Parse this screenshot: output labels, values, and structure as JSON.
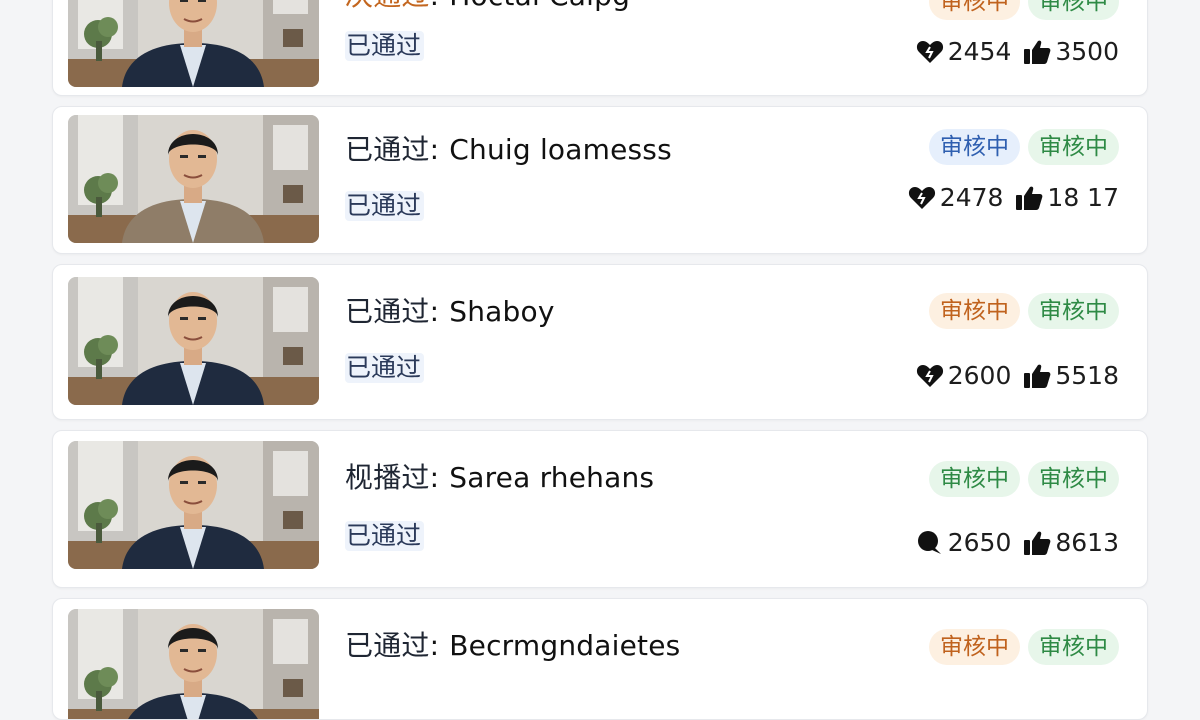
{
  "items": [
    {
      "title_prefix": "决通过",
      "title_name": "Hoctal Calpg",
      "status": "已通过",
      "badges": [
        {
          "label": "审核中",
          "color": "#c0621d"
        },
        {
          "label": "审核中",
          "color": "#2e8a45"
        }
      ],
      "stat_icon_1": "heart-icon",
      "stat_1": "2454",
      "stat_icon_2": "thumbs-up-icon",
      "stat_2": "3500"
    },
    {
      "title_prefix": "已通过",
      "title_name": "Chuig loamesss",
      "status": "已通过",
      "badges": [
        {
          "label": "审核中",
          "color": "#2f5fb0"
        },
        {
          "label": "审核中",
          "color": "#2e8a45"
        }
      ],
      "stat_icon_1": "heart-icon",
      "stat_1": "2478",
      "stat_icon_2": "thumbs-up-icon",
      "stat_2": "18 17"
    },
    {
      "title_prefix": "已通过",
      "title_name": "Shaboy",
      "status": "已通过",
      "badges": [
        {
          "label": "审核中",
          "color": "#c0621d"
        },
        {
          "label": "审核中",
          "color": "#2e8a45"
        }
      ],
      "stat_icon_1": "heart-icon",
      "stat_1": "2600",
      "stat_icon_2": "thumbs-up-icon",
      "stat_2": "5518"
    },
    {
      "title_prefix": "枧播过",
      "title_name": "Sarea rhehans",
      "status": "已通过",
      "badges": [
        {
          "label": "审核中",
          "color": "#2e8a45"
        },
        {
          "label": "审核中",
          "color": "#2e8a45"
        }
      ],
      "stat_icon_1": "comment-icon",
      "stat_1": "2650",
      "stat_icon_2": "thumbs-up-icon",
      "stat_2": "8613"
    },
    {
      "title_prefix": "已通过",
      "title_name": "Becrmgndaietes",
      "status": "",
      "badges": [
        {
          "label": "审核中",
          "color": "#c0621d"
        },
        {
          "label": "审核中",
          "color": "#2e8a45"
        }
      ],
      "stat_icon_1": "",
      "stat_1": "",
      "stat_icon_2": "",
      "stat_2": ""
    }
  ]
}
